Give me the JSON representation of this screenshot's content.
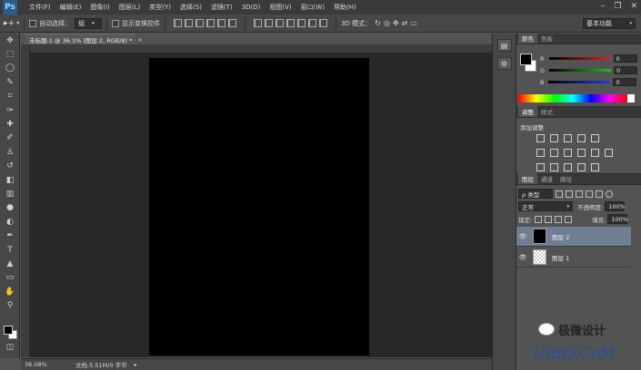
{
  "app": {
    "logo": "Ps"
  },
  "menu": [
    "文件(F)",
    "编辑(E)",
    "图像(I)",
    "图层(L)",
    "类型(Y)",
    "选择(S)",
    "滤镜(T)",
    "3D(D)",
    "视图(V)",
    "窗口(W)",
    "帮助(H)"
  ],
  "options_bar": {
    "auto_select_label": "自动选择：",
    "auto_select_value": "组",
    "show_transform_label": "显示变换控件",
    "mode_3d_label": "3D 模式：",
    "workspace": "基本功能"
  },
  "document": {
    "tab_title": "未标题-1 @ 36.1% (图层 2, RGB/8) *",
    "canvas_color": "#000000"
  },
  "status": {
    "zoom": "36.08%",
    "doc_info": "文档:5.51M/0 字节"
  },
  "color_panel": {
    "tabs": [
      "颜色",
      "色板"
    ],
    "channels": [
      {
        "label": "R",
        "value": "0",
        "color": "#e02020"
      },
      {
        "label": "G",
        "value": "0",
        "color": "#20c020"
      },
      {
        "label": "B",
        "value": "0",
        "color": "#2040e0"
      }
    ]
  },
  "adjustments_panel": {
    "tabs": [
      "调整",
      "样式"
    ],
    "title": "添加调整"
  },
  "layers_panel": {
    "tabs": [
      "图层",
      "通道",
      "路径"
    ],
    "filter_kind": "ρ 类型",
    "blend_mode": "正常",
    "opacity_label": "不透明度:",
    "opacity_value": "100%",
    "lock_label": "锁定:",
    "fill_label": "填充:",
    "fill_value": "100%",
    "layers": [
      {
        "name": "图层 2",
        "selected": true,
        "thumb": "black"
      },
      {
        "name": "图层 1",
        "selected": false,
        "thumb": "transparent"
      }
    ]
  },
  "watermark": {
    "line1": "极微设计",
    "line2": "UiBQ.CoM"
  },
  "colors": {
    "app_bg": "#535353",
    "selection": "#6f7f93"
  }
}
